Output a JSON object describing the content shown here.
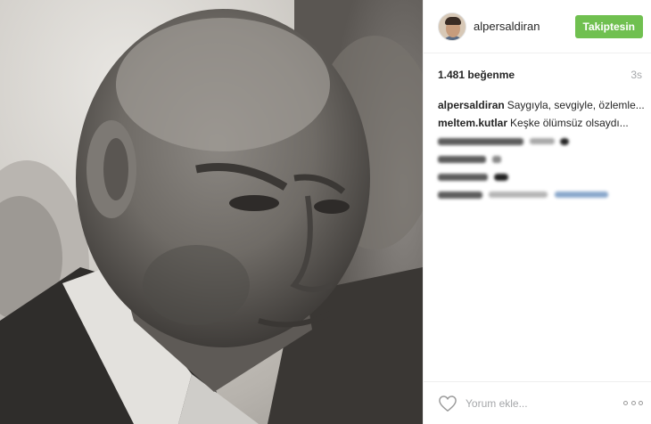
{
  "post": {
    "photo": {
      "icon": "portrait-photo"
    },
    "header": {
      "username": "alpersaldiran",
      "follow_label": "Takiptesin",
      "follow_color": "#70c050"
    },
    "likes": "1.481 beğenme",
    "time": "3s",
    "comments": [
      {
        "user": "alpersaldiran",
        "text": "Saygıyla, sevgiyle, özlemle..."
      },
      {
        "user": "meltem.kutlar",
        "text": "Keşke ölümsüz olsaydı..."
      }
    ],
    "comment_placeholder": "Yorum ekle...",
    "icons": {
      "like": "heart-icon",
      "more": "more-options-icon"
    }
  }
}
